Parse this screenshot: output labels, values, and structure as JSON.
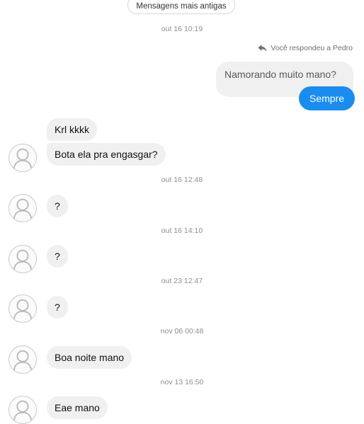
{
  "older_messages_label": "Mensagens mais antigas",
  "reply_note": "Você respondeu a Pedro",
  "timestamps": [
    "out 16 10:19",
    "out 16 12:48",
    "out 16 14:10",
    "out 23 12:47",
    "nov 06 00:48",
    "nov 13 16:50"
  ],
  "quoted_message": "Namorando muito mano?",
  "sent_message": "Sempre",
  "received": [
    "Krl kkkk",
    "Bota ela pra engasgar?",
    "?",
    "?",
    "?",
    "Boa noite mano",
    "Eae mano"
  ],
  "colors": {
    "sent_bubble": "#1a8cf0",
    "received_bubble": "#f0f0f0",
    "timestamp": "#8e8e8e"
  },
  "icons": {
    "reply": "reply-arrow-icon",
    "avatar": "default-avatar-icon"
  }
}
